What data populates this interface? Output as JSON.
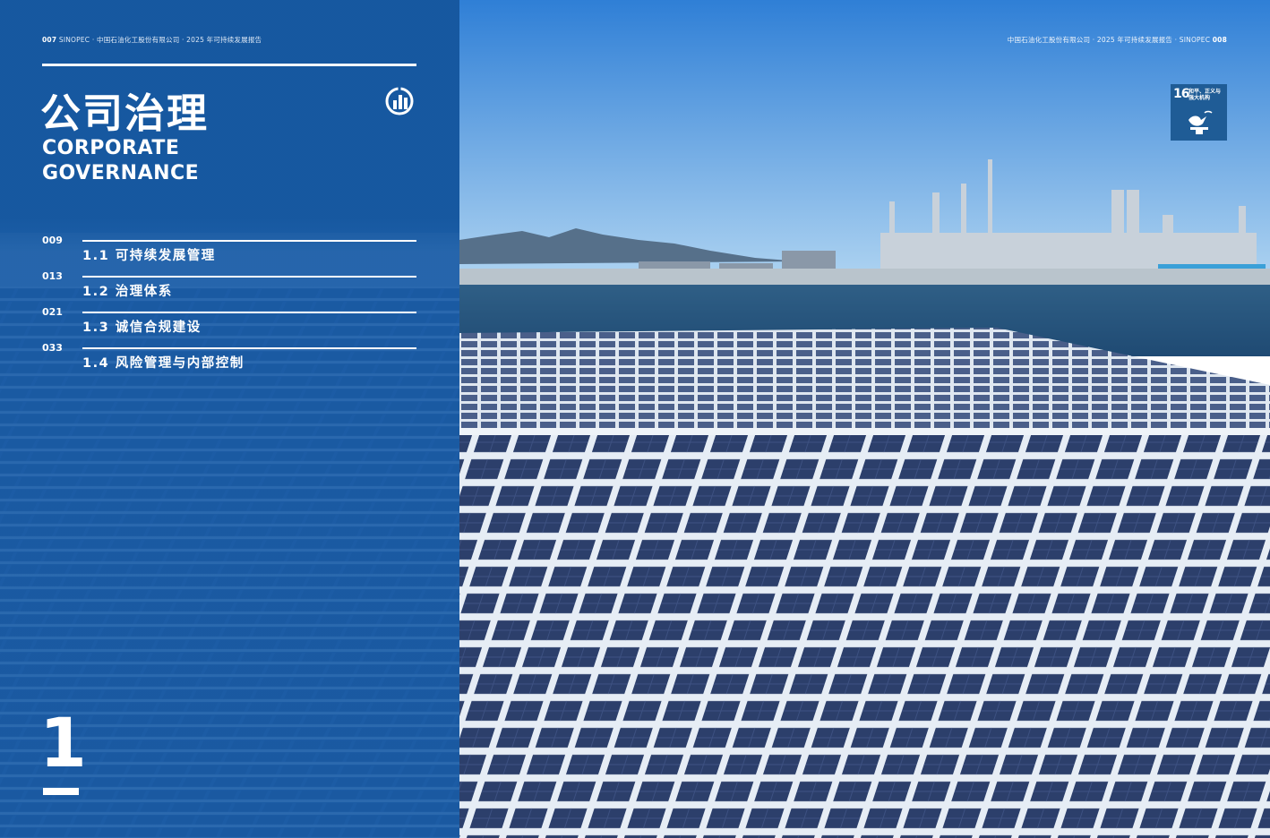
{
  "left_page": {
    "header_page": "007",
    "header_text": "SINOPEC · 中国石油化工股份有限公司 · 2025 年可持续发展报告",
    "title_cn": "公司治理",
    "title_en_line1": "CORPORATE",
    "title_en_line2": "GOVERNANCE",
    "toc": [
      {
        "page": "009",
        "label": "1.1 可持续发展管理"
      },
      {
        "page": "013",
        "label": "1.2 治理体系"
      },
      {
        "page": "021",
        "label": "1.3 诚信合规建设"
      },
      {
        "page": "033",
        "label": "1.4 风险管理与内部控制"
      }
    ],
    "chapter_number": "1",
    "icon": "bar-chart-circle-icon"
  },
  "right_page": {
    "header_text": "中国石油化工股份有限公司 · 2025 年可持续发展报告 · SINOPEC",
    "header_page": "008",
    "sdg_badge": {
      "number": "16",
      "text": "和平、正义与强大机构",
      "icon": "dove-gavel-icon"
    }
  },
  "colors": {
    "brand_blue": "#1658a0",
    "sdg_blue": "#1f5c96",
    "white": "#ffffff"
  }
}
